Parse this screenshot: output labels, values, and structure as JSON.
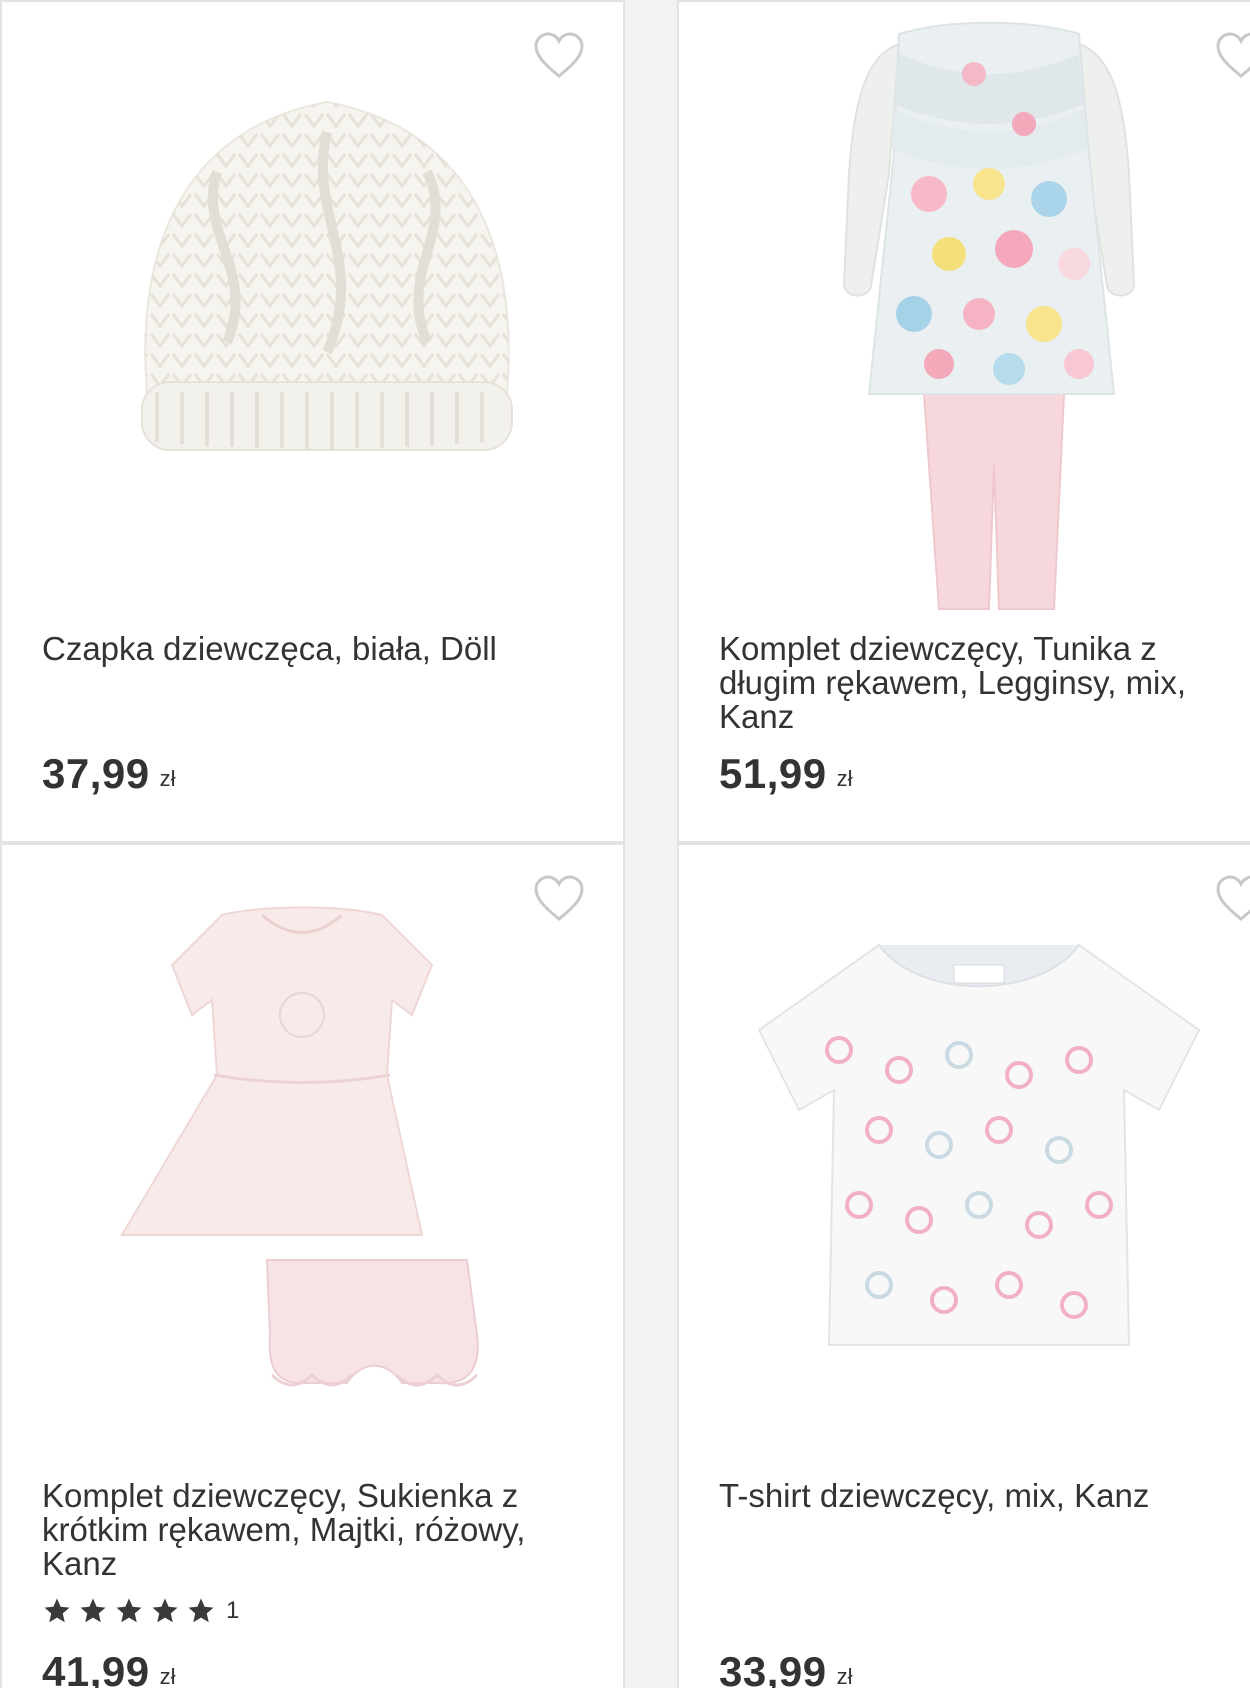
{
  "products": [
    {
      "title": "Czapka dziewczęca, biała, Döll",
      "price": "37,99",
      "currency": "zł",
      "image_icon": "knit-hat-image"
    },
    {
      "title": "Komplet dziewczęcy, Tunika z długim rękawem, Legginsy, mix, Kanz",
      "price": "51,99",
      "currency": "zł",
      "image_icon": "tunic-leggings-image"
    },
    {
      "title": "Komplet dziewczęcy, Sukienka z krótkim rękawem, Majtki, różowy, Kanz",
      "price": "41,99",
      "currency": "zł",
      "rating_stars": 5,
      "rating_count": "1",
      "image_icon": "dress-bloomers-image"
    },
    {
      "title": "T-shirt dziewczęcy, mix, Kanz",
      "price": "33,99",
      "currency": "zł",
      "image_icon": "tshirt-image"
    }
  ],
  "colors": {
    "heart_outline": "#c8c8c8",
    "text": "#333333",
    "star": "#3a3a3a",
    "card_border": "#e3e3e3"
  }
}
